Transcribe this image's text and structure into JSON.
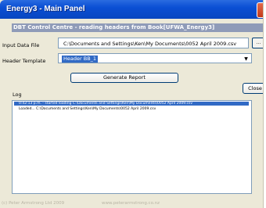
{
  "window": {
    "title": "Energy3 - Main Panel"
  },
  "banner": {
    "text": "DBT Control Centre - reading headers from Book[UFWA_Energy3]"
  },
  "input_file": {
    "label": "Input Data File",
    "value": "C:\\Documents and Settings\\Ken\\My Documents\\0052 April 2009.csv",
    "browse_label": "..."
  },
  "header_template": {
    "label": "Header Template",
    "selected": "Header BB_1"
  },
  "buttons": {
    "generate": "Generate Report",
    "close": "Close"
  },
  "log": {
    "label": "Log",
    "lines": [
      "0:42:13 p.m. - started loading C:\\Documents and Settings\\Ken\\My Documents\\0052 April 2009.csv",
      "Loaded... C:\\Documents and Settings\\Ken\\My Documents\\0052 April 2009.csv"
    ]
  },
  "footer": {
    "copyright": "(c) Peter Armstrong Ltd 2009",
    "website": "www.peterarmstrong.co.nz"
  },
  "colors": {
    "titlebar": "#0a4fd4",
    "banner": "#8f9bb8",
    "selection": "#316ac5",
    "window_bg": "#ece9d8"
  }
}
